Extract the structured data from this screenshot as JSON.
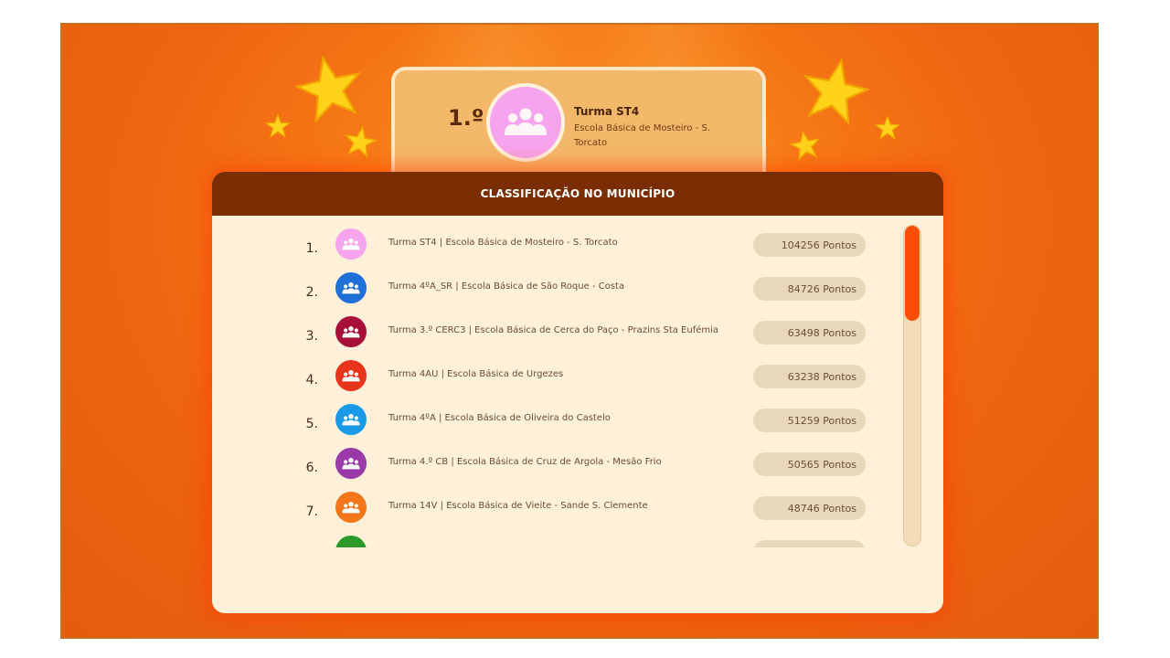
{
  "top_card": {
    "rank": "1.º",
    "name": "Turma ST4",
    "school": "Escola Básica de Mosteiro - S. Torcato",
    "avatar_color": "#f7a4ee"
  },
  "panel": {
    "title": "CLASSIFICAÇÃO NO MUNICÍPIO"
  },
  "rows": [
    {
      "rank": "1.",
      "text": "Turma ST4 | Escola Básica de Mosteiro - S. Torcato",
      "points": "104256 Pontos",
      "color": "#f7a4ee"
    },
    {
      "rank": "2.",
      "text": "Turma 4ºA_SR | Escola Básica de São Roque - Costa",
      "points": "84726 Pontos",
      "color": "#1f6fd8"
    },
    {
      "rank": "3.",
      "text": "Turma 3.º CERC3 | Escola Básica de Cerca do Paço - Prazins Sta Eufémia",
      "points": "63498 Pontos",
      "color": "#a8103a"
    },
    {
      "rank": "4.",
      "text": "Turma 4AU | Escola Básica de Urgezes",
      "points": "63238 Pontos",
      "color": "#e8341c"
    },
    {
      "rank": "5.",
      "text": "Turma 4ºA | Escola Básica de Oliveira do Castelo",
      "points": "51259 Pontos",
      "color": "#1a9ae8"
    },
    {
      "rank": "6.",
      "text": "Turma 4.º CB | Escola Básica de Cruz de Argola - Mesão Frio",
      "points": "50565 Pontos",
      "color": "#9a3aa8"
    },
    {
      "rank": "7.",
      "text": "Turma 14V | Escola Básica de Vieite - Sande S. Clemente",
      "points": "48746 Pontos",
      "color": "#f4761a"
    },
    {
      "rank": "",
      "text": "",
      "points": "",
      "color": "#2e9a2a"
    }
  ],
  "scroll": {
    "position": 0.0
  }
}
